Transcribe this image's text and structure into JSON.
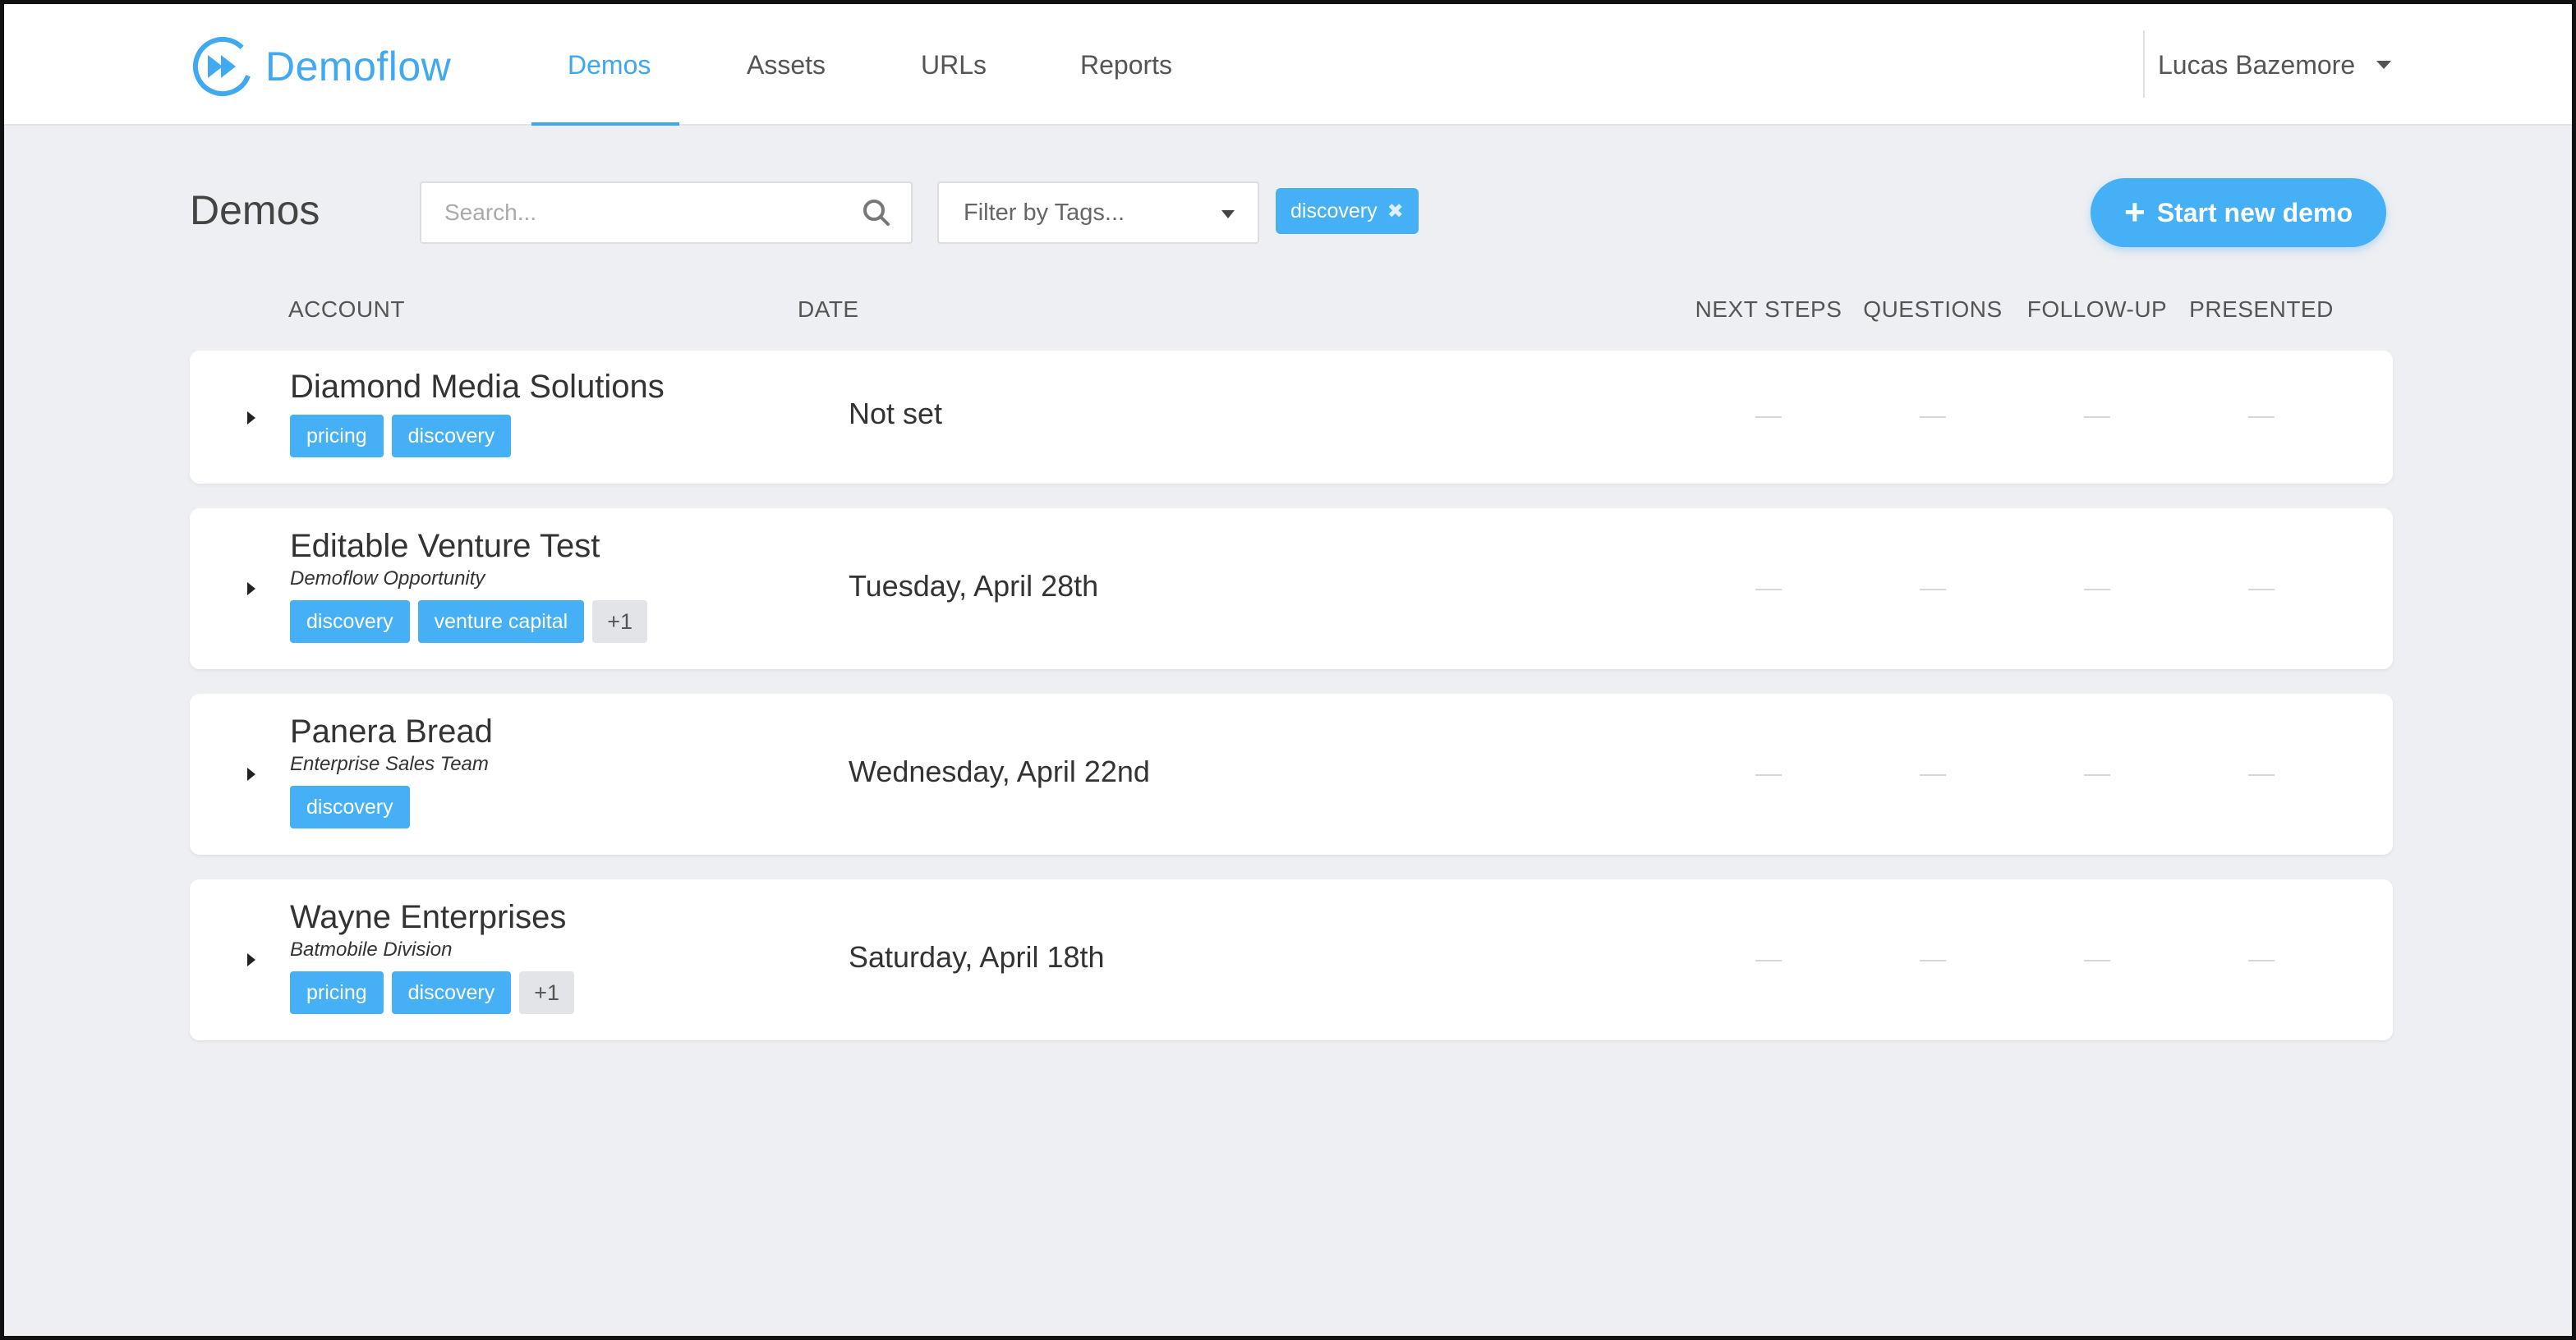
{
  "brand": {
    "name": "Demoflow",
    "color": "#40a9f0"
  },
  "nav": {
    "items": [
      {
        "label": "Demos",
        "active": true
      },
      {
        "label": "Assets",
        "active": false
      },
      {
        "label": "URLs",
        "active": false
      },
      {
        "label": "Reports",
        "active": false
      }
    ],
    "user": "Lucas Bazemore"
  },
  "toolbar": {
    "title": "Demos",
    "search_placeholder": "Search...",
    "filter_placeholder": "Filter by Tags...",
    "active_filter": "discovery",
    "remove_filter_icon": "✖",
    "new_demo_label": "Start new demo"
  },
  "table": {
    "columns": {
      "account": "ACCOUNT",
      "date": "DATE",
      "next_steps": "NEXT STEPS",
      "questions": "QUESTIONS",
      "follow_up": "FOLLOW-UP",
      "presented": "PRESENTED"
    },
    "rows": [
      {
        "name": "Diamond Media Solutions",
        "subtitle": "",
        "tags": [
          "pricing",
          "discovery"
        ],
        "more": "",
        "date": "Not set"
      },
      {
        "name": "Editable Venture Test",
        "subtitle": "Demoflow Opportunity",
        "tags": [
          "discovery",
          "venture capital"
        ],
        "more": "+1",
        "date": "Tuesday, April 28th"
      },
      {
        "name": "Panera Bread",
        "subtitle": "Enterprise Sales Team",
        "tags": [
          "discovery"
        ],
        "more": "",
        "date": "Wednesday, April 22nd"
      },
      {
        "name": "Wayne Enterprises",
        "subtitle": "Batmobile Division",
        "tags": [
          "pricing",
          "discovery"
        ],
        "more": "+1",
        "date": "Saturday, April 18th"
      }
    ]
  },
  "colors": {
    "accent": "#45b0f5",
    "background": "#eeeff2",
    "card": "#ffffff"
  }
}
